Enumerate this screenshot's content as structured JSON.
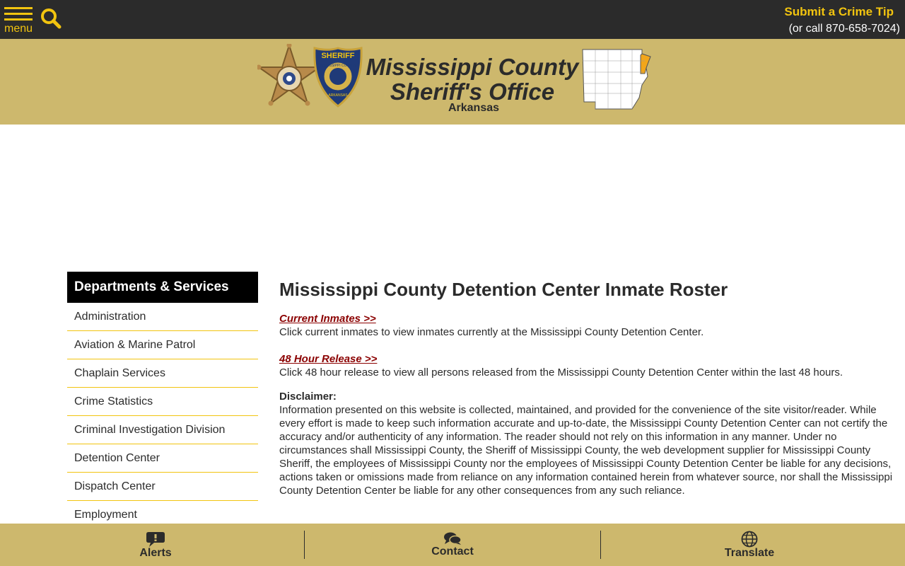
{
  "topbar": {
    "menu_label": "menu",
    "crime_tip_label": "Submit a Crime Tip",
    "crime_tip_phone": "(or call 870-658-7024)"
  },
  "header": {
    "title_line1": "Mississippi County",
    "title_line2": "Sheriff's Office",
    "subtitle": "Arkansas",
    "shield_badge_text": "SHERIFF",
    "shield_badge_ring": "MISSISSIPPI COUNTY",
    "shield_badge_state": "ARKANSAS"
  },
  "sidebar": {
    "heading": "Departments & Services",
    "items": [
      "Administration",
      "Aviation & Marine Patrol",
      "Chaplain Services",
      "Crime Statistics",
      "Criminal Investigation Division",
      "Detention Center",
      "Dispatch Center",
      "Employment"
    ]
  },
  "main": {
    "title": "Mississippi County Detention Center Inmate Roster",
    "current_link": "Current Inmates >>",
    "current_desc": "Click current inmates to view inmates currently at the Mississippi County Detention Center.",
    "release_link": "48 Hour Release >>",
    "release_desc": "Click 48 hour release to view all persons released from the Mississippi County Detention Center within the last 48 hours.",
    "disclaimer_label": "Disclaimer:",
    "disclaimer_text": "Information presented on this website is collected, maintained, and provided for the convenience of the site visitor/reader. While every effort is made to keep such information accurate and up-to-date, the Mississippi County Detention Center can not certify the accuracy and/or authenticity of any information. The reader should not rely on this information in any manner.  Under no circumstances shall Mississippi County, the Sheriff of Mississippi County, the web development supplier for Mississippi County Sheriff, the employees of Mississippi County nor the employees of Mississippi County Detention Center be liable for any decisions, actions taken or omissions made from reliance on any information contained herein from whatever source, nor shall the Mississippi County Detention Center be liable for any other consequences from any such reliance."
  },
  "bottombar": {
    "alerts_label": "Alerts",
    "contact_label": "Contact",
    "translate_label": "Translate"
  },
  "icons": {
    "menu": "hamburger-icon",
    "search": "search-icon",
    "alerts": "alert-bubble-icon",
    "contact": "chat-bubbles-icon",
    "translate": "globe-icon"
  },
  "colors": {
    "topbar": "#2b2b2b",
    "accent_yellow": "#f2c40f",
    "header_gold": "#cdb86d",
    "link_red": "#8b0000",
    "sidebar_head": "#000000"
  }
}
